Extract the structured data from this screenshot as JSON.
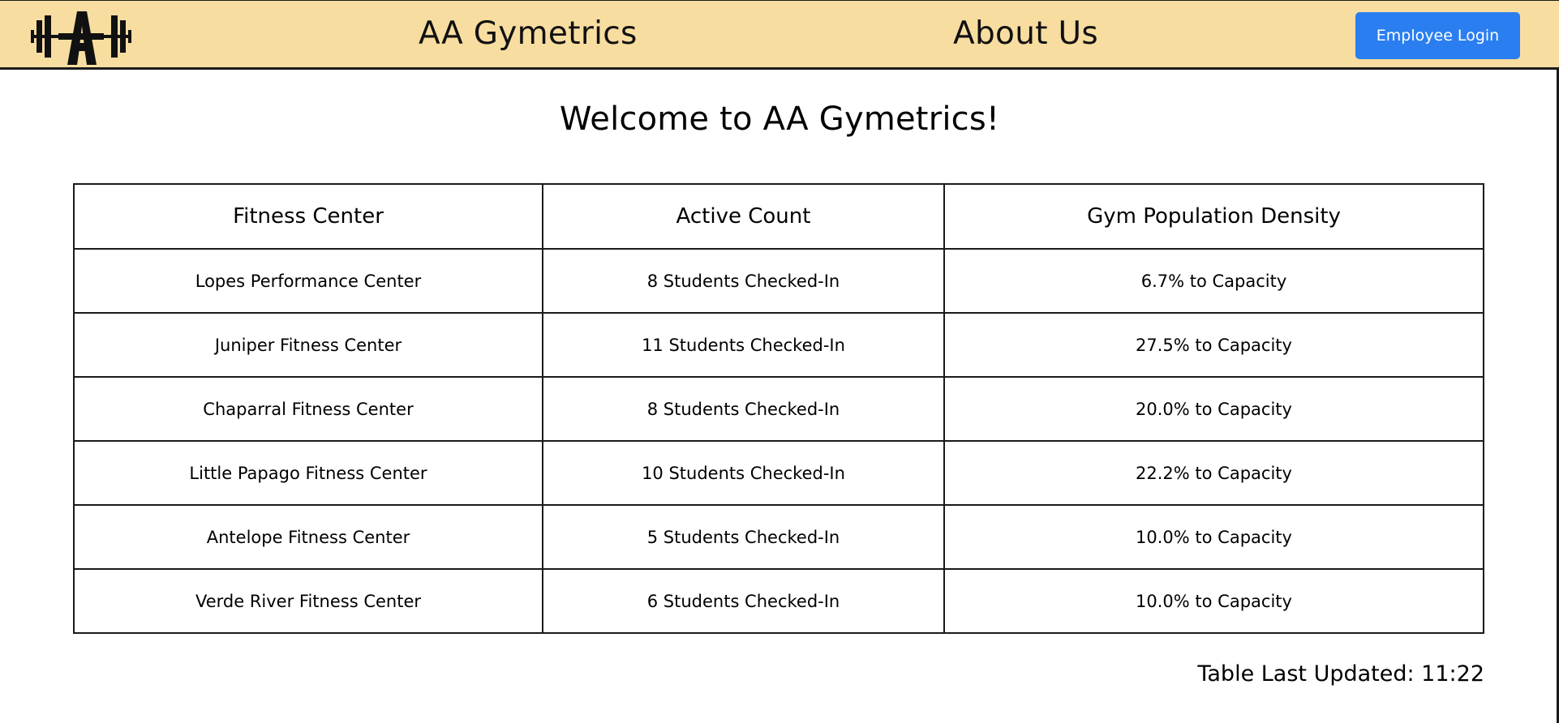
{
  "nav": {
    "brand": "AA Gymetrics",
    "about": "About Us",
    "login_label": "Employee Login",
    "logo_icon": "barbell-A-logo-icon"
  },
  "colors": {
    "navbar_bg": "#f8dda0",
    "button_bg": "#2a7ef0"
  },
  "main": {
    "title": "Welcome to AA Gymetrics!"
  },
  "table": {
    "headers": [
      "Fitness Center",
      "Active Count",
      "Gym Population Density"
    ],
    "rows": [
      {
        "center": "Lopes Performance Center",
        "count": "8 Students Checked-In",
        "density": "6.7% to Capacity"
      },
      {
        "center": "Juniper Fitness Center",
        "count": "11 Students Checked-In",
        "density": "27.5% to Capacity"
      },
      {
        "center": "Chaparral Fitness Center",
        "count": "8 Students Checked-In",
        "density": "20.0% to Capacity"
      },
      {
        "center": "Little Papago Fitness Center",
        "count": "10 Students Checked-In",
        "density": "22.2% to Capacity"
      },
      {
        "center": "Antelope Fitness Center",
        "count": "5 Students Checked-In",
        "density": "10.0% to Capacity"
      },
      {
        "center": "Verde River Fitness Center",
        "count": "6 Students Checked-In",
        "density": "10.0% to Capacity"
      }
    ]
  },
  "footer": {
    "last_updated": "Table Last Updated: 11:22"
  }
}
